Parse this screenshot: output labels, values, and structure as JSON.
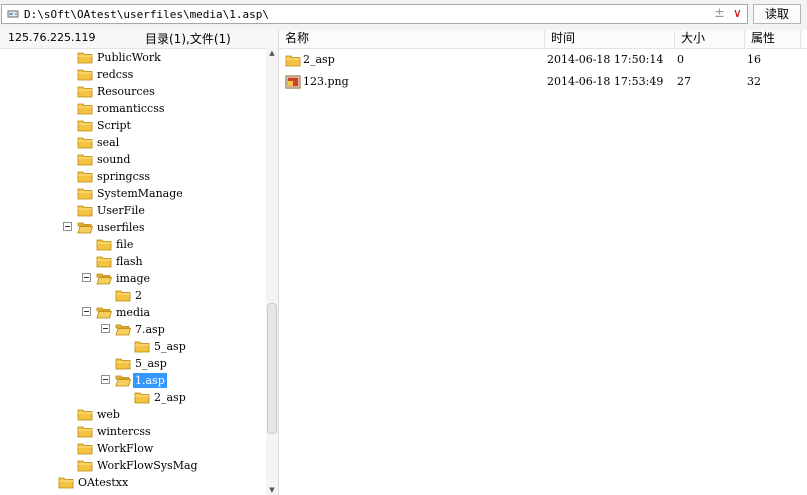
{
  "address_bar": {
    "path": "D:\\sOft\\OAtest\\userfiles\\media\\1.asp\\",
    "icon": "drive-icon",
    "plus_minus": "±",
    "dropdown": "∨",
    "read_button": "读取"
  },
  "left_header": {
    "ip": "125.76.225.119",
    "counts": "目录(1),文件(1)"
  },
  "tree": [
    {
      "label": "PublicWork"
    },
    {
      "label": "redcss"
    },
    {
      "label": "Resources"
    },
    {
      "label": "romanticcss"
    },
    {
      "label": "Script"
    },
    {
      "label": "seal"
    },
    {
      "label": "sound"
    },
    {
      "label": "springcss"
    },
    {
      "label": "SystemManage"
    },
    {
      "label": "UserFile"
    },
    {
      "label": "userfiles"
    },
    {
      "label": "file"
    },
    {
      "label": "flash"
    },
    {
      "label": "image"
    },
    {
      "label": "2"
    },
    {
      "label": "media"
    },
    {
      "label": "7.asp"
    },
    {
      "label": "5_asp"
    },
    {
      "label": "5_asp"
    },
    {
      "label": "1.asp"
    },
    {
      "label": "2_asp"
    },
    {
      "label": "web"
    },
    {
      "label": "wintercss"
    },
    {
      "label": "WorkFlow"
    },
    {
      "label": "WorkFlowSysMag"
    },
    {
      "label": "OAtestxx"
    }
  ],
  "file_list": {
    "columns": [
      "名称",
      "时间",
      "大小",
      "属性"
    ],
    "rows": [
      {
        "icon": "folder-icon",
        "name": "2_asp",
        "time": "2014-06-18 17:50:14",
        "size": "0",
        "attr": "16"
      },
      {
        "icon": "image-file-icon",
        "name": "123.png",
        "time": "2014-06-18 17:53:49",
        "size": "27",
        "attr": "32"
      }
    ]
  },
  "colors": {
    "selection": "#3399ff",
    "folder": "#f5c342"
  }
}
